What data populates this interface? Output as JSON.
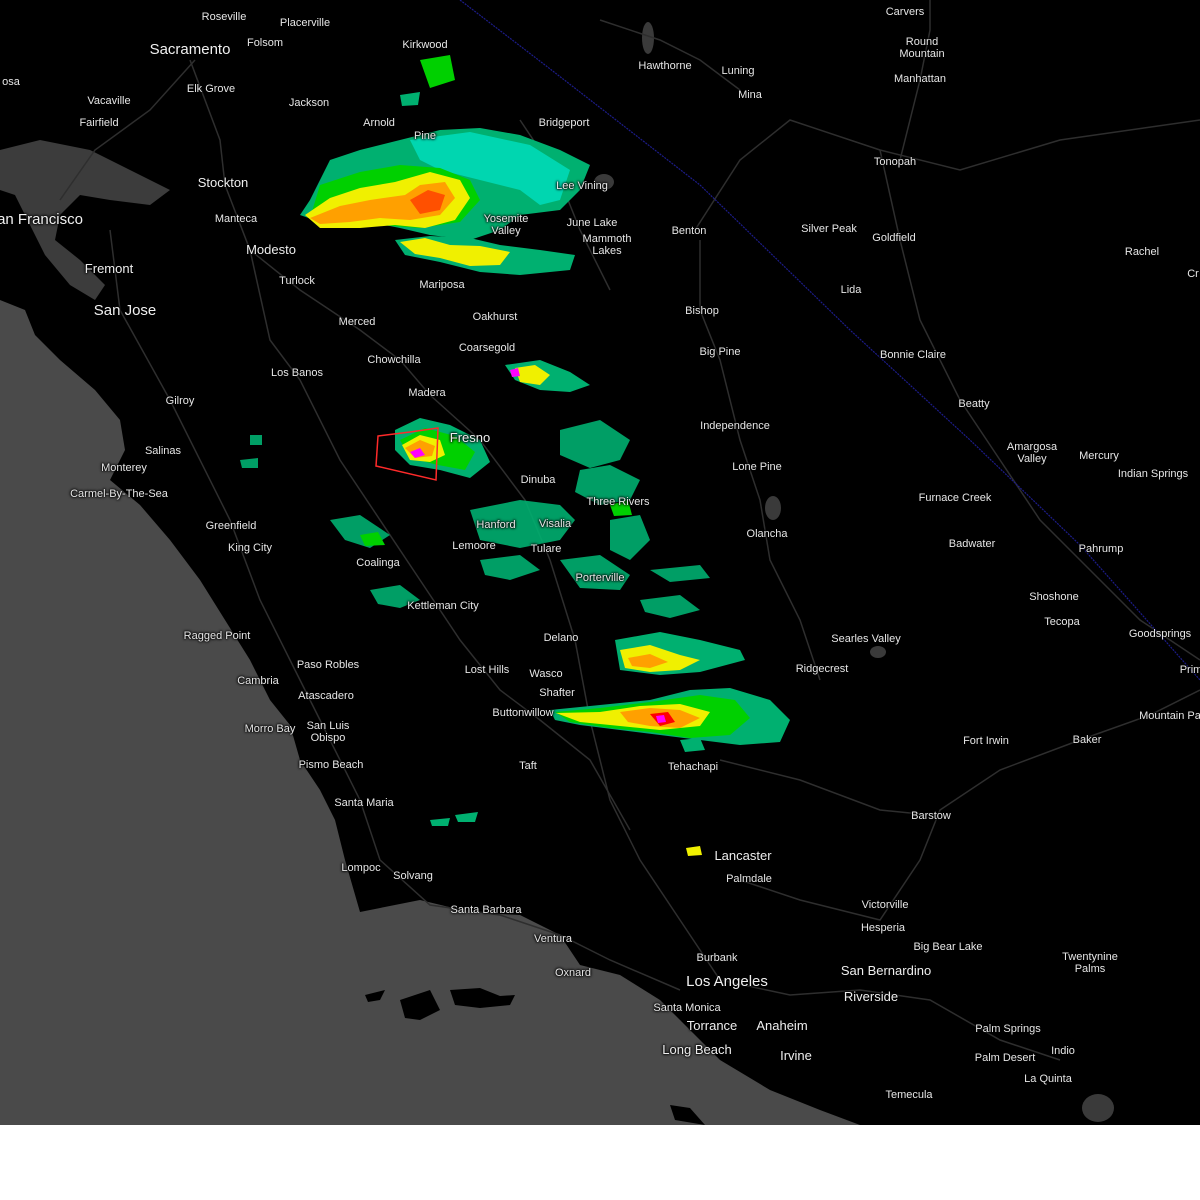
{
  "map": {
    "colors": {
      "land": "#000000",
      "ocean": "#4a4a4a",
      "lake": "#3c3c3c",
      "road": "#2c2c2c",
      "border": "#1c1c8a",
      "warning_polygon": "#ff2a2a",
      "radar_scale": [
        "#00e0c0",
        "#00b070",
        "#00d000",
        "#f0f000",
        "#ffa000",
        "#ff5000",
        "#ff0000",
        "#ff00ff"
      ]
    },
    "places": [
      {
        "name": "Roseville",
        "size": "small"
      },
      {
        "name": "Placerville",
        "size": "small"
      },
      {
        "name": "Sacramento",
        "size": "big"
      },
      {
        "name": "Folsom",
        "size": "small"
      },
      {
        "name": "Kirkwood",
        "size": "small"
      },
      {
        "name": "Carvers",
        "size": "small"
      },
      {
        "name": "Round Mountain",
        "size": "small"
      },
      {
        "name": "Manhattan",
        "size": "small"
      },
      {
        "name": "Hawthorne",
        "size": "small"
      },
      {
        "name": "Luning",
        "size": "small"
      },
      {
        "name": "Mina",
        "size": "small"
      },
      {
        "name": "osa",
        "size": "small"
      },
      {
        "name": "Vacaville",
        "size": "small"
      },
      {
        "name": "Elk Grove",
        "size": "small"
      },
      {
        "name": "Jackson",
        "size": "small"
      },
      {
        "name": "Fairfield",
        "size": "small"
      },
      {
        "name": "Arnold",
        "size": "small"
      },
      {
        "name": "Pine",
        "size": "small"
      },
      {
        "name": "Bridgeport",
        "size": "small"
      },
      {
        "name": "Tonopah",
        "size": "small"
      },
      {
        "name": "Stockton",
        "size": "med"
      },
      {
        "name": "Lee Vining",
        "size": "small"
      },
      {
        "name": "an Francisco",
        "size": "big"
      },
      {
        "name": "Manteca",
        "size": "small"
      },
      {
        "name": "Yosemite Valley",
        "size": "small"
      },
      {
        "name": "June Lake",
        "size": "small"
      },
      {
        "name": "Benton",
        "size": "small"
      },
      {
        "name": "Silver Peak",
        "size": "small"
      },
      {
        "name": "Goldfield",
        "size": "small"
      },
      {
        "name": "Rachel",
        "size": "small"
      },
      {
        "name": "Cr",
        "size": "small"
      },
      {
        "name": "Mammoth Lakes",
        "size": "small"
      },
      {
        "name": "Modesto",
        "size": "med"
      },
      {
        "name": "Fremont",
        "size": "med"
      },
      {
        "name": "Turlock",
        "size": "small"
      },
      {
        "name": "Mariposa",
        "size": "small"
      },
      {
        "name": "Lida",
        "size": "small"
      },
      {
        "name": "San Jose",
        "size": "big"
      },
      {
        "name": "Bishop",
        "size": "small"
      },
      {
        "name": "Oakhurst",
        "size": "small"
      },
      {
        "name": "Merced",
        "size": "small"
      },
      {
        "name": "Coarsegold",
        "size": "small"
      },
      {
        "name": "Big Pine",
        "size": "small"
      },
      {
        "name": "Bonnie Claire",
        "size": "small"
      },
      {
        "name": "Chowchilla",
        "size": "small"
      },
      {
        "name": "Los Banos",
        "size": "small"
      },
      {
        "name": "Madera",
        "size": "small"
      },
      {
        "name": "Gilroy",
        "size": "small"
      },
      {
        "name": "Beatty",
        "size": "small"
      },
      {
        "name": "Independence",
        "size": "small"
      },
      {
        "name": "Fresno",
        "size": "med"
      },
      {
        "name": "Amargosa Valley",
        "size": "small"
      },
      {
        "name": "Salinas",
        "size": "small"
      },
      {
        "name": "Mercury",
        "size": "small"
      },
      {
        "name": "Lone Pine",
        "size": "small"
      },
      {
        "name": "Monterey",
        "size": "small"
      },
      {
        "name": "Indian Springs",
        "size": "small"
      },
      {
        "name": "Dinuba",
        "size": "small"
      },
      {
        "name": "Carmel-By-The-Sea",
        "size": "small"
      },
      {
        "name": "Furnace Creek",
        "size": "small"
      },
      {
        "name": "Three Rivers",
        "size": "small"
      },
      {
        "name": "Greenfield",
        "size": "small"
      },
      {
        "name": "Hanford",
        "size": "small"
      },
      {
        "name": "Visalia",
        "size": "small"
      },
      {
        "name": "Olancha",
        "size": "small"
      },
      {
        "name": "King City",
        "size": "small"
      },
      {
        "name": "Lemoore",
        "size": "small"
      },
      {
        "name": "Tulare",
        "size": "small"
      },
      {
        "name": "Badwater",
        "size": "small"
      },
      {
        "name": "Pahrump",
        "size": "small"
      },
      {
        "name": "Coalinga",
        "size": "small"
      },
      {
        "name": "Porterville",
        "size": "small"
      },
      {
        "name": "Shoshone",
        "size": "small"
      },
      {
        "name": "Kettleman City",
        "size": "small"
      },
      {
        "name": "Tecopa",
        "size": "small"
      },
      {
        "name": "Goodsprings",
        "size": "small"
      },
      {
        "name": "Ragged Point",
        "size": "small"
      },
      {
        "name": "Delano",
        "size": "small"
      },
      {
        "name": "Searles Valley",
        "size": "small"
      },
      {
        "name": "Paso Robles",
        "size": "small"
      },
      {
        "name": "Lost Hills",
        "size": "small"
      },
      {
        "name": "Ridgecrest",
        "size": "small"
      },
      {
        "name": "Prim",
        "size": "small"
      },
      {
        "name": "Cambria",
        "size": "small"
      },
      {
        "name": "Wasco",
        "size": "small"
      },
      {
        "name": "Atascadero",
        "size": "small"
      },
      {
        "name": "Shafter",
        "size": "small"
      },
      {
        "name": "Buttonwillow",
        "size": "small"
      },
      {
        "name": "Mountain Pa",
        "size": "small"
      },
      {
        "name": "Morro Bay",
        "size": "small"
      },
      {
        "name": "San Luis Obispo",
        "size": "small"
      },
      {
        "name": "Fort Irwin",
        "size": "small"
      },
      {
        "name": "Baker",
        "size": "small"
      },
      {
        "name": "Pismo Beach",
        "size": "small"
      },
      {
        "name": "Taft",
        "size": "small"
      },
      {
        "name": "Tehachapi",
        "size": "small"
      },
      {
        "name": "Santa Maria",
        "size": "small"
      },
      {
        "name": "Barstow",
        "size": "small"
      },
      {
        "name": "Lancaster",
        "size": "med"
      },
      {
        "name": "Lompoc",
        "size": "small"
      },
      {
        "name": "Palmdale",
        "size": "small"
      },
      {
        "name": "Solvang",
        "size": "small"
      },
      {
        "name": "Victorville",
        "size": "small"
      },
      {
        "name": "Santa Barbara",
        "size": "small"
      },
      {
        "name": "Hesperia",
        "size": "small"
      },
      {
        "name": "Ventura",
        "size": "small"
      },
      {
        "name": "Big Bear Lake",
        "size": "small"
      },
      {
        "name": "Twentynine Palms",
        "size": "small"
      },
      {
        "name": "Burbank",
        "size": "small"
      },
      {
        "name": "Oxnard",
        "size": "small"
      },
      {
        "name": "San Bernardino",
        "size": "med"
      },
      {
        "name": "Los Angeles",
        "size": "big"
      },
      {
        "name": "Riverside",
        "size": "med"
      },
      {
        "name": "Santa Monica",
        "size": "small"
      },
      {
        "name": "Palm Springs",
        "size": "small"
      },
      {
        "name": "Torrance",
        "size": "med"
      },
      {
        "name": "Anaheim",
        "size": "med"
      },
      {
        "name": "Long Beach",
        "size": "med"
      },
      {
        "name": "Irvine",
        "size": "med"
      },
      {
        "name": "Palm Desert",
        "size": "small"
      },
      {
        "name": "Indio",
        "size": "small"
      },
      {
        "name": "La Quinta",
        "size": "small"
      },
      {
        "name": "Temecula",
        "size": "small"
      }
    ]
  }
}
